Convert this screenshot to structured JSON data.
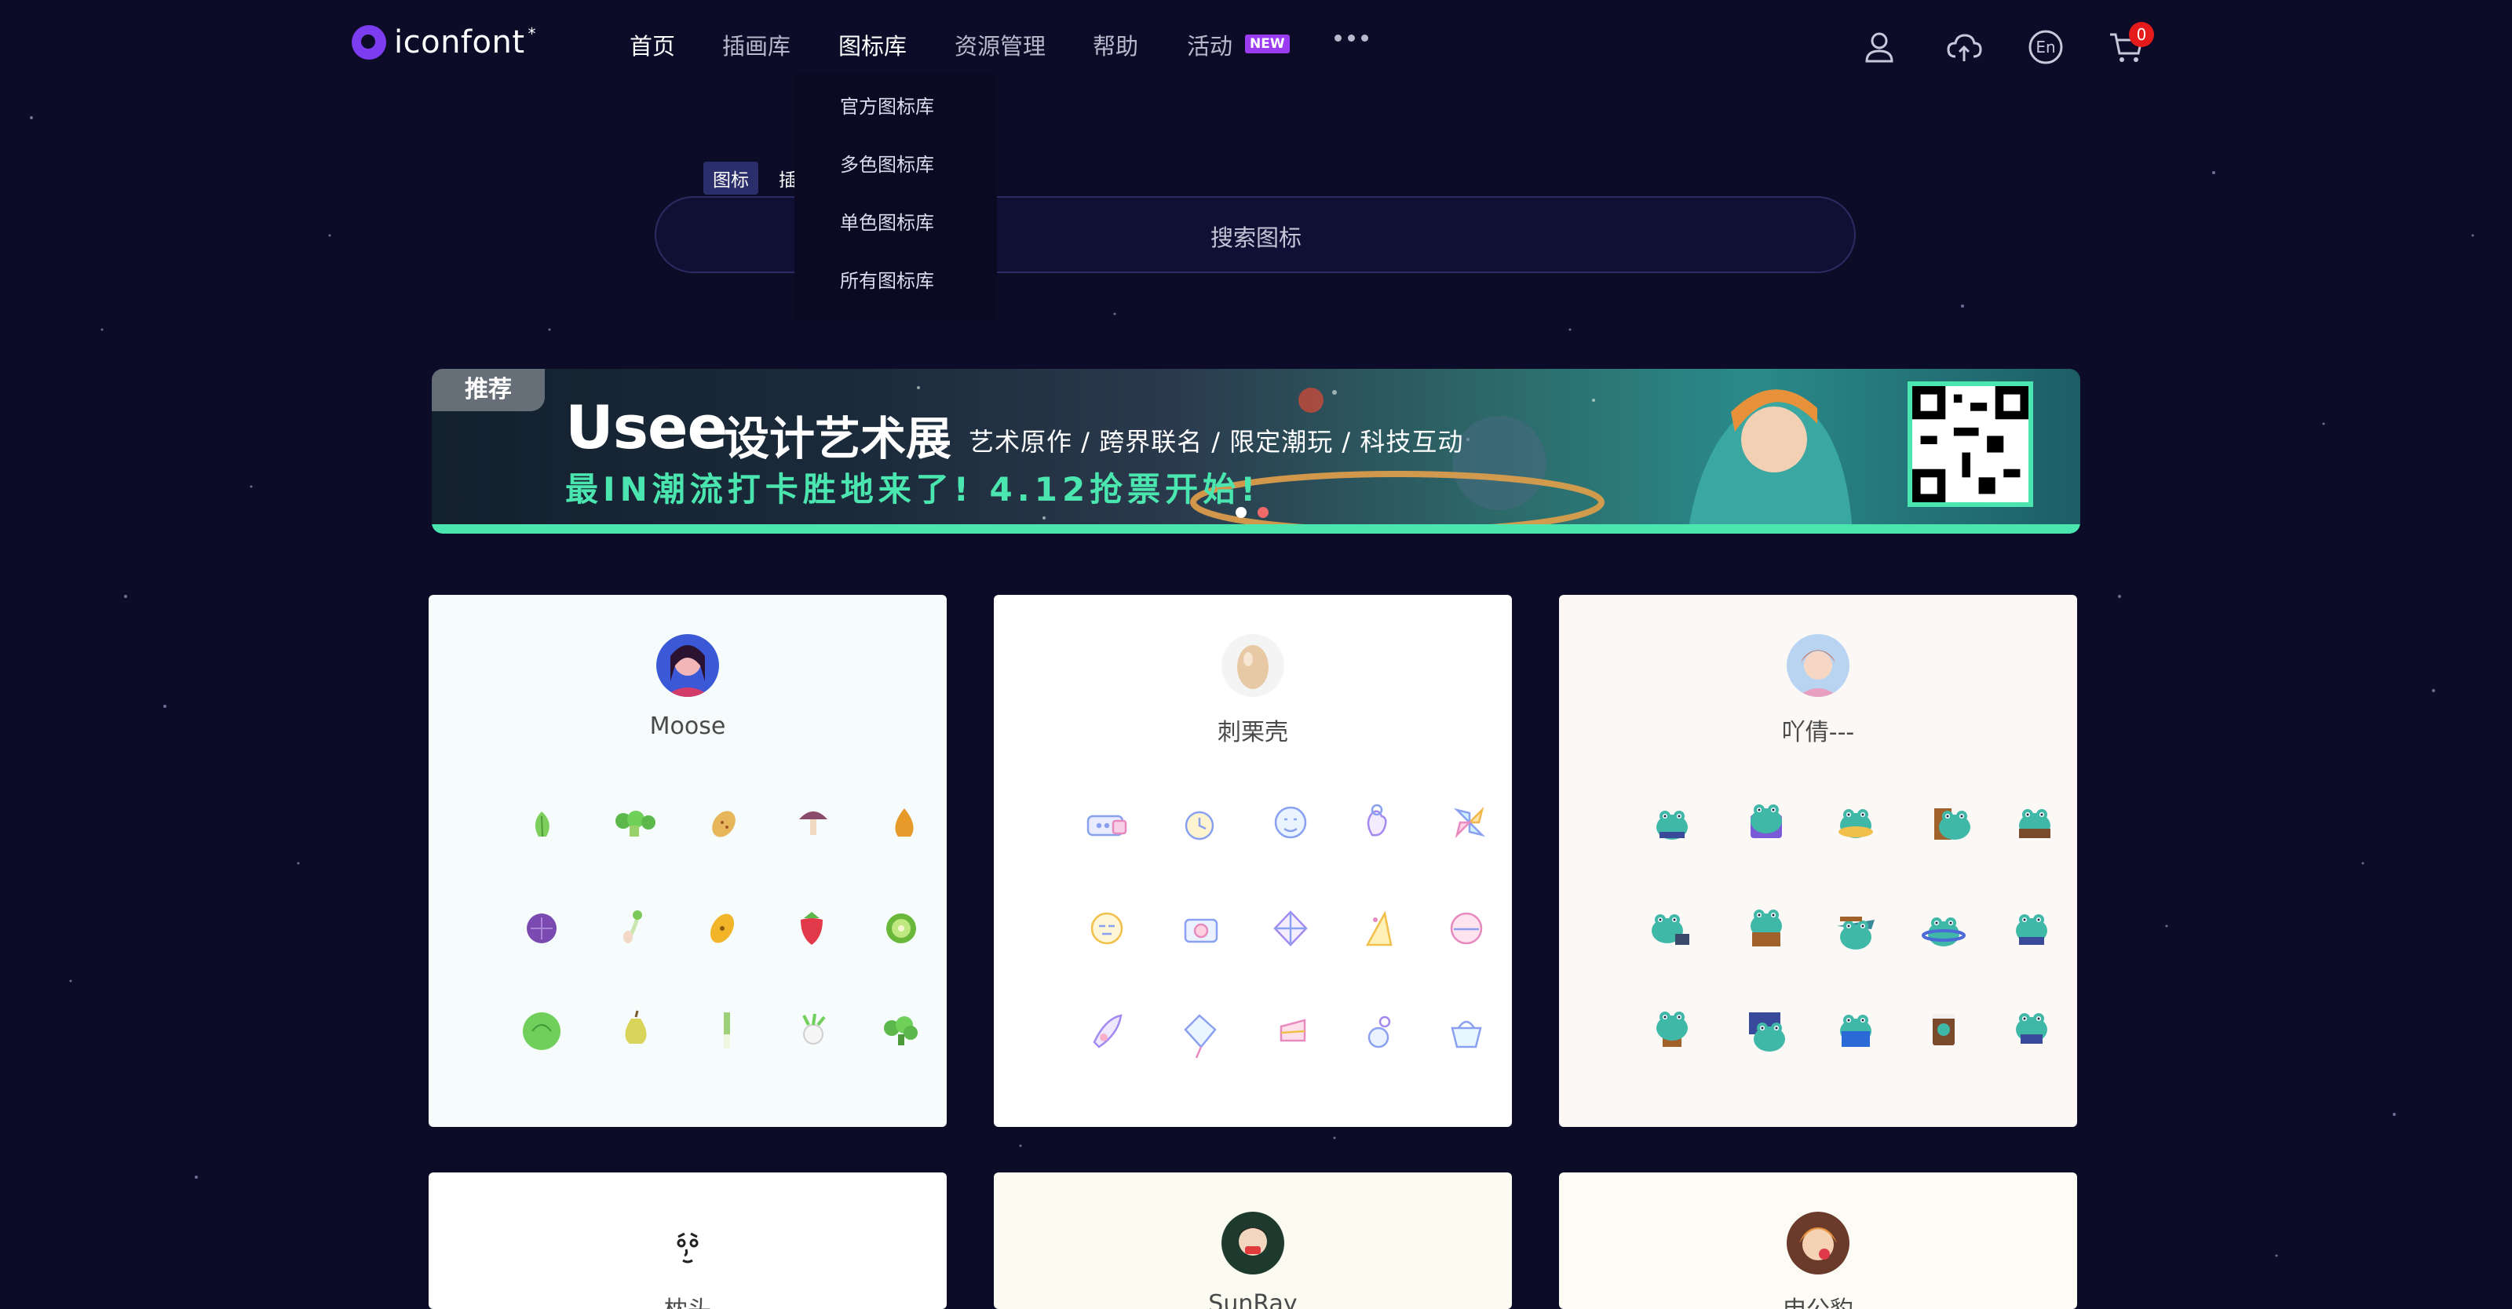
{
  "header": {
    "logo_text": "iconfont",
    "nav": [
      {
        "label": "首页",
        "active": true
      },
      {
        "label": "插画库",
        "active": false
      },
      {
        "label": "图标库",
        "active": true
      },
      {
        "label": "资源管理",
        "active": false
      },
      {
        "label": "帮助",
        "active": false
      },
      {
        "label": "活动",
        "active": false
      }
    ],
    "new_badge": "NEW",
    "lang": "En",
    "cart_count": "0",
    "icons": [
      "user-icon",
      "upload-cloud-icon",
      "language-icon",
      "cart-icon"
    ]
  },
  "dropdown": {
    "items": [
      "官方图标库",
      "多色图标库",
      "单色图标库",
      "所有图标库"
    ]
  },
  "search": {
    "tabs": [
      "图标",
      "插"
    ],
    "placeholder": "搜索图标"
  },
  "banner": {
    "tag": "推荐",
    "brand": "Usee",
    "title": "设计艺术展",
    "subtitle": "艺术原作 / 跨界联名 / 限定潮玩 / 科技互动",
    "slogan": "最IN潮流打卡胜地来了! 4.12抢票开始!"
  },
  "cards": [
    {
      "name": "Moose",
      "bg": "#f6fcfc"
    },
    {
      "name": "刺栗壳",
      "bg": "#ffffff"
    },
    {
      "name": "吖倩---",
      "bg": "#fcf8f6"
    },
    {
      "name": "枕头",
      "bg": "#ffffff"
    },
    {
      "name": "SunRay",
      "bg": "#fbfbf1"
    },
    {
      "name": "申公豹",
      "bg": "#fcfbf4"
    }
  ],
  "colors": {
    "background": "#0d0c28",
    "accent_green": "#4be6b0",
    "badge_purple": "#9b3cf3",
    "cart_red": "#e51a1a"
  }
}
